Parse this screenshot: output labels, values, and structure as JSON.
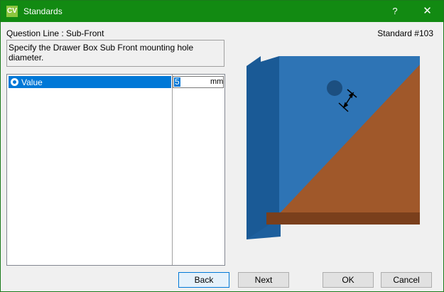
{
  "window": {
    "title": "Standards",
    "app_icon_text": "CV",
    "help_label": "?",
    "close_label": "✕",
    "titlebar_color": "#128a12"
  },
  "question": {
    "line_label": "Question Line : Sub-Front",
    "standard_label": "Standard #103",
    "description": "Specify the Drawer Box Sub Front mounting hole diameter."
  },
  "list": {
    "rows": [
      {
        "label": "Value",
        "value": "5",
        "unit": "mm",
        "selected": true
      }
    ]
  },
  "buttons": {
    "back": "Back",
    "next": "Next",
    "ok": "OK",
    "cancel": "Cancel"
  },
  "colors": {
    "selection": "#0078d7",
    "panel_blue": "#2e74b5",
    "panel_dark_blue": "#1a5a96",
    "wood": "#a0582a",
    "wood_dark": "#7a3f1c"
  }
}
